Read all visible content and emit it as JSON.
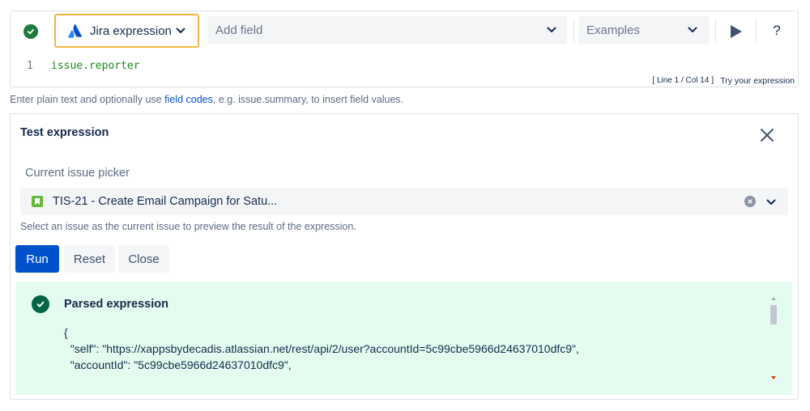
{
  "editor": {
    "expression_type": "Jira expression",
    "field_placeholder": "Add field",
    "examples_placeholder": "Examples",
    "help_label": "?",
    "line_number": "1",
    "code": "issue.reporter",
    "cursor_info": "[ Line 1 / Col 14 ]",
    "try_label": "Try your expression"
  },
  "hint": {
    "before": "Enter plain text and optionally use ",
    "link": "field codes",
    "after": ", e.g. issue.summary, to insert field values."
  },
  "test_panel": {
    "title": "Test expression",
    "picker_label": "Current issue picker",
    "selected_issue": "TIS-21 - Create Email Campaign for Satu...",
    "picker_help": "Select an issue as the current issue to preview the result of the expression.",
    "buttons": {
      "run": "Run",
      "reset": "Reset",
      "close": "Close"
    },
    "result": {
      "title": "Parsed expression",
      "lines": [
        "{",
        "  \"self\": \"https://xappsbydecadis.atlassian.net/rest/api/2/user?accountId=5c99cbe5966d24637010dfc9\",",
        "  \"accountId\": \"5c99cbe5966d24637010dfc9\","
      ]
    }
  },
  "colors": {
    "primary": "#0052cc",
    "success": "#006644",
    "success_bg": "#e3fcef",
    "focus_border": "#f2b542",
    "story": "#63ba3c"
  },
  "icons": [
    "check-circle-icon",
    "atlassian-logo-icon",
    "chevron-down-icon",
    "play-icon",
    "close-icon",
    "story-icon",
    "clear-icon"
  ]
}
